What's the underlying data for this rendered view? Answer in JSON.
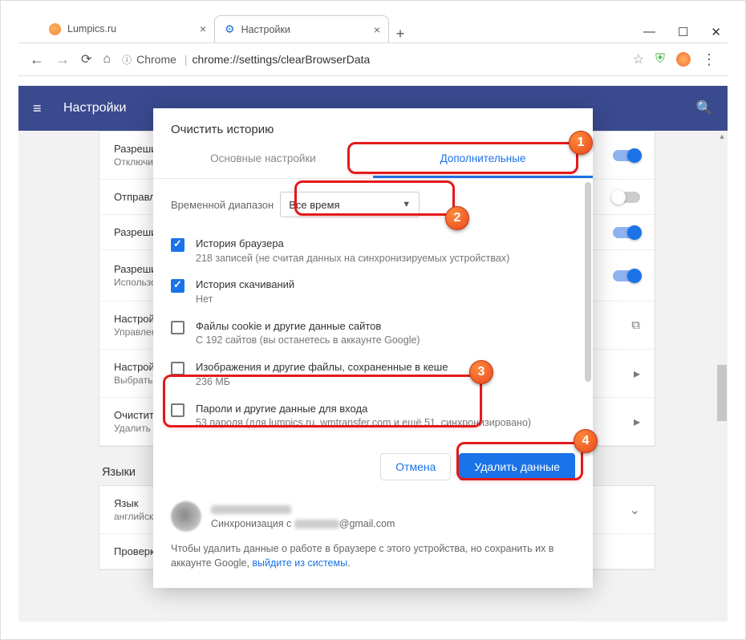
{
  "window": {
    "minimize": "—",
    "maximize": "☐",
    "close": "✕"
  },
  "tabs": {
    "items": [
      {
        "label": "Lumpics.ru"
      },
      {
        "label": "Настройки"
      }
    ],
    "newtab": "+"
  },
  "nav": {
    "back": "←",
    "forward": "→",
    "reload": "⟳",
    "home": "⌂"
  },
  "addr": {
    "protocol": "Chrome",
    "url": "chrome://settings/clearBrowserData",
    "star": "☆",
    "shield": "⛨",
    "menu": "⋮",
    "lock": "ⓘ"
  },
  "header": {
    "hamburger": "≡",
    "title": "Настройки",
    "search": "🔍"
  },
  "rows": {
    "r1": {
      "t": "Разрешить…",
      "s": "Отключите эту функцию, если она вам не нужна. При необходим…"
    },
    "r2": {
      "t": "Отправлять…"
    },
    "r3": {
      "t": "Разрешить…"
    },
    "r4": {
      "t": "Разрешить…",
      "s": "Использов…\nоткрывает…"
    },
    "r5": {
      "t": "Настройки…",
      "s": "Управлени…"
    },
    "r6": {
      "t": "Настройки…",
      "s": "Выбрать, в…"
    },
    "r7": {
      "t": "Очистить и…",
      "s": "Удалить ф…"
    },
    "langSection": "Языки",
    "r8": {
      "t": "Язык",
      "s": "английски…"
    },
    "r9": {
      "t": "Проверка правописания"
    }
  },
  "dialog": {
    "title": "Очистить историю",
    "tab_basic": "Основные настройки",
    "tab_advanced": "Дополнительные",
    "range_label": "Временной диапазон",
    "range_value": "Все время",
    "items": [
      {
        "label": "История браузера",
        "sub": "218 записей (не считая данных на синхронизируемых устройствах)",
        "checked": true
      },
      {
        "label": "История скачиваний",
        "sub": "Нет",
        "checked": true
      },
      {
        "label": "Файлы cookie и другие данные сайтов",
        "sub": "С 192 сайтов (вы останетесь в аккаунте Google)",
        "checked": false
      },
      {
        "label": "Изображения и другие файлы, сохраненные в кеше",
        "sub": "236 МБ",
        "checked": false
      },
      {
        "label": "Пароли и другие данные для входа",
        "sub": "53 пароля (для lumpics.ru, wmtransfer.com и ещё 51, синхронизировано)",
        "checked": false
      }
    ],
    "cancel": "Отмена",
    "confirm": "Удалить данные",
    "sync_prefix": "Синхронизация с ",
    "sync_email_suffix": "@gmail.com",
    "footer_text": "Чтобы удалить данные о работе в браузере с этого устройства, но сохранить их в аккаунте Google, ",
    "footer_link": "выйдите из системы",
    "footer_dot": "."
  },
  "steps": {
    "s1": "1",
    "s2": "2",
    "s3": "3",
    "s4": "4"
  }
}
